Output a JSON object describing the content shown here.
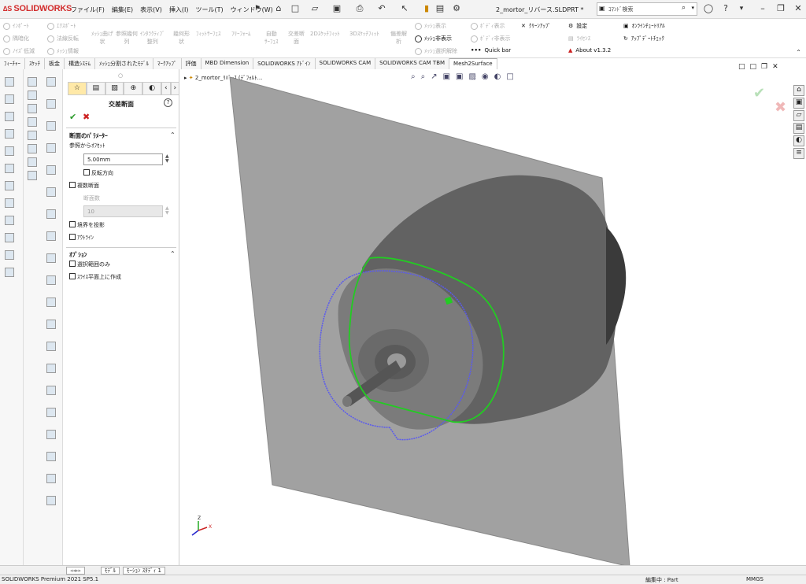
{
  "app": {
    "logo_text": "SOLIDWORKS",
    "document_title": "2_mortor_リバース.SLDPRT *"
  },
  "menu": [
    "ファイル(F)",
    "編集(E)",
    "表示(V)",
    "挿入(I)",
    "ツール(T)",
    "ウィンドウ(W)"
  ],
  "search": {
    "placeholder": "ｺﾏﾝﾄﾞ検索"
  },
  "ribbon": {
    "import": "ｲﾝﾎﾟｰﾄ",
    "export": "ｴｸｽﾎﾟｰﾄ",
    "mesh_fold": "ﾒｯｼｭ曲げ",
    "mesh_fold2": "状",
    "ref_geom": "参照幾何",
    "ref_geom2": "列",
    "interactive": "ｲﾝﾀﾗｸﾃｨﾌﾞ",
    "interactive2": "整列",
    "geom_shape": "幾何形",
    "geom_shape2": "状",
    "fit_surface": "ﾌｨｯﾄｻｰﾌｪｽ",
    "freeform": "ﾌﾘｰﾌｫｰﾑ",
    "auto_surface": "自動",
    "auto_surface2": "ｻｰﾌｪｽ",
    "cross_section": "交差断",
    "cross_section2": "面",
    "sketch2d": "2Dｽｹｯﾁﾌｨｯﾄ",
    "sketch3d": "3Dｽｹｯﾁﾌｨｯﾄ",
    "deviation": "偏差解",
    "deviation2": "析",
    "smooth": "隅暗化",
    "normal_flip": "法線反転",
    "noise": "ﾉｲｽﾞ低減",
    "mesh_info": "ﾒｯｼｭ情報",
    "mesh_show": "ﾒｯｼｭ表示",
    "mesh_hide": "ﾒｯｼｭ非表示",
    "mesh_sel_clear": "ﾒｯｼｭ選択解除",
    "body_show": "ﾎﾞﾃﾞｨ表示",
    "body_hide": "ﾎﾞﾃﾞｨ非表示",
    "quick_bar": "Quick bar",
    "cleanup": "ｸﾘｰﾝｱｯﾌﾟ",
    "settings": "設定",
    "license": "ﾗｲｾﾝｽ",
    "about": "About v1.3.2",
    "tutorial": "ｵﾝﾗｲﾝﾁｭｰﾄﾘｱﾙ",
    "update": "ｱｯﾌﾟﾃﾞｰﾄﾁｪｯｸ"
  },
  "command_tabs": [
    "ﾌｨｰﾁｬｰ",
    "ｽｹｯﾁ",
    "板金",
    "構造ｼｽﾃﾑ",
    "ﾒｯｼｭ分割されたﾓﾃﾞﾙ",
    "ﾏｰｸｱｯﾌﾟ",
    "評価",
    "MBD Dimension",
    "SOLIDWORKS ｱﾄﾞｲﾝ",
    "SOLIDWORKS CAM",
    "SOLIDWORKS CAM TBM",
    "Mesh2Surface"
  ],
  "tree": {
    "item": "2_mortor_ﾘﾊﾞｰｽ (ﾃﾞﾌｫﾙﾄ..."
  },
  "panel": {
    "title": "交差断面",
    "section_params": "断面のﾊﾟﾗﾒｰﾀｰ",
    "offset_label": "参照からｵﾌｾｯﾄ",
    "offset_value": "5.00mm",
    "reverse": "反転方向",
    "multi": "複数断面",
    "count_label": "断面数",
    "count_value": "10",
    "project_boundary": "境界を投影",
    "outline": "ｱｳﾄﾗｲﾝ",
    "options": "ｵﾌﾟｼｮﾝ",
    "selection_only": "選択範囲のみ",
    "create_on_plane": "ｽﾗｲｽ平面上に作成"
  },
  "bottom_tabs": [
    "ﾓﾃﾞﾙ",
    "ﾓｰｼｮﾝ ｽﾀﾃﾞｨ 1"
  ],
  "status": {
    "product": "SOLIDWORKS Premium 2021 SP5.1",
    "editing": "編集中 : Part",
    "units": "MMGS"
  },
  "colors": {
    "accent_red": "#d22d2d",
    "section_green": "#22cc22",
    "section_blue": "#5a5aee",
    "plane_gray": "#9a9a9a"
  }
}
